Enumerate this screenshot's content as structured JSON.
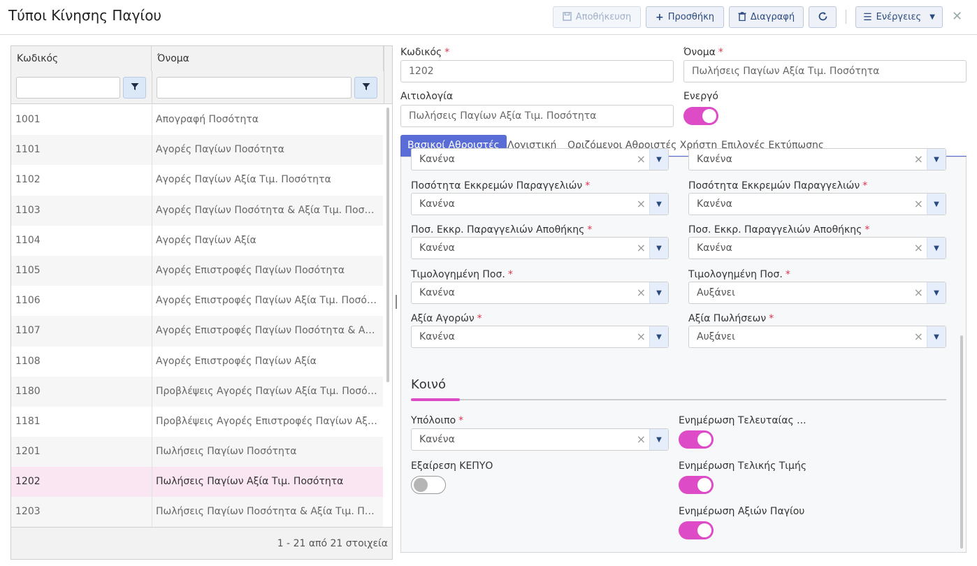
{
  "header": {
    "title": "Τύποι Κίνησης Παγίου",
    "save_label": "Αποθήκευση",
    "add_label": "Προσθήκη",
    "delete_label": "Διαγραφή",
    "actions_label": "Ενέργειες",
    "close_glyph": "✕"
  },
  "grid": {
    "col_code": "Κωδικός",
    "col_name": "Όνομα",
    "rows": [
      {
        "code": "1001",
        "name": "Απογραφή Ποσότητα"
      },
      {
        "code": "1101",
        "name": "Αγορές Παγίων Ποσότητα"
      },
      {
        "code": "1102",
        "name": "Αγορές Παγίων Αξία Τιμ. Ποσότητα"
      },
      {
        "code": "1103",
        "name": "Αγορές Παγίων Ποσότητα & Αξία Τιμ. Ποσότητα"
      },
      {
        "code": "1104",
        "name": "Αγορές Παγίων Αξία"
      },
      {
        "code": "1105",
        "name": "Αγορές Επιστροφές Παγίων Ποσότητα"
      },
      {
        "code": "1106",
        "name": "Αγορές Επιστροφές Παγίων Αξία Τιμ. Ποσότητα"
      },
      {
        "code": "1107",
        "name": "Αγορές Επιστροφές Παγίων Ποσότητα & Αξία Τ..."
      },
      {
        "code": "1108",
        "name": "Αγορές Επιστροφές Παγίων Αξία"
      },
      {
        "code": "1180",
        "name": "Προβλέψεις Αγορές Παγίων Αξία Τιμ. Ποσότητα"
      },
      {
        "code": "1181",
        "name": "Προβλέψεις Αγορές Επιστροφές Παγίων Αξία Τ..."
      },
      {
        "code": "1201",
        "name": "Πωλήσεις Παγίων Ποσότητα"
      },
      {
        "code": "1202",
        "name": "Πωλήσεις Παγίων Αξία Τιμ. Ποσότητα"
      },
      {
        "code": "1203",
        "name": "Πωλήσεις Παγίων Ποσότητα & Αξία Τιμ. Ποσότ..."
      }
    ],
    "selected_code": "1202",
    "pager": "1 - 21 από 21 στοιχεία"
  },
  "form": {
    "code_label": "Κωδικός",
    "code_value": "1202",
    "name_label": "Όνομα",
    "name_value": "Πωλήσεις Παγίων Αξία Τιμ. Ποσότητα",
    "reason_label": "Αιτιολογία",
    "reason_value": "Πωλήσεις Παγίων Αξία Τιμ. Ποσότητα",
    "active_label": "Ενεργό",
    "active_on": true,
    "required_mark": "*"
  },
  "tabs": [
    "Βασικοί Αθροιστές",
    "Λογιστική",
    "Οριζόμενοι Αθροιστές Χρήστη",
    "Επιλογές Εκτύπωσης"
  ],
  "panel": {
    "top_left_value": "Κανένα",
    "top_right_value": "Κανένα",
    "left": [
      {
        "label": "Ποσότητα Εκκρεμών Παραγγελιών",
        "value": "Κανένα"
      },
      {
        "label": "Ποσ. Εκκρ. Παραγγελιών Αποθήκης",
        "value": "Κανένα"
      },
      {
        "label": "Τιμολογημένη Ποσ.",
        "value": "Κανένα"
      },
      {
        "label": "Αξία Αγορών",
        "value": "Κανένα"
      }
    ],
    "right": [
      {
        "label": "Ποσότητα Εκκρεμών Παραγγελιών",
        "value": "Κανένα"
      },
      {
        "label": "Ποσ. Εκκρ. Παραγγελιών Αποθήκης",
        "value": "Κανένα"
      },
      {
        "label": "Τιμολογημένη Ποσ.",
        "value": "Αυξάνει"
      },
      {
        "label": "Αξία Πωλήσεων",
        "value": "Αυξάνει"
      }
    ],
    "section_title": "Κοινό",
    "balance_label": "Υπόλοιπο",
    "balance_value": "Κανένα",
    "exclude_label": "Εξαίρεση ΚΕΠΥΟ",
    "exclude_on": false,
    "update_last_label": "Ενημέρωση Τελευταίας ...",
    "update_last_on": true,
    "update_final_label": "Ενημέρωση Τελικής Τιμής",
    "update_final_on": true,
    "update_values_label": "Ενημέρωση Αξιών Παγίου",
    "update_values_on": true
  },
  "colors": {
    "accent": "#dd4bc6",
    "tab_active": "#5a6cd6",
    "selected_row": "#fae6f2"
  }
}
